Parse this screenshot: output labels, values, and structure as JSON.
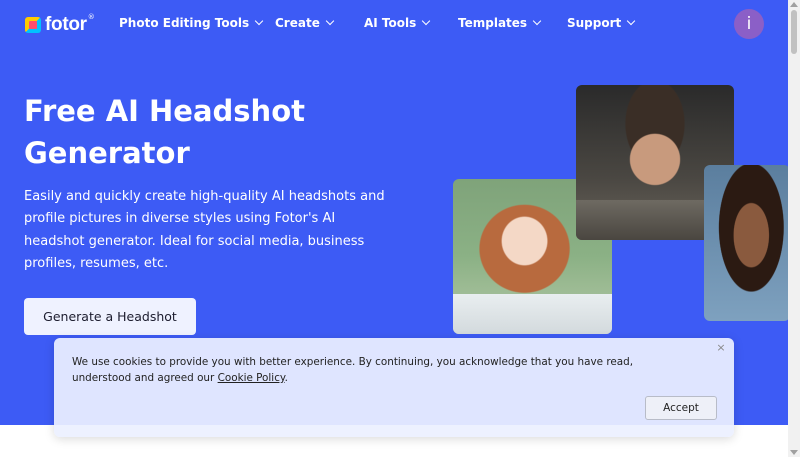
{
  "brand": {
    "logo_text": "fotor",
    "logo_mark": "®"
  },
  "nav": {
    "items": [
      {
        "label": "Photo Editing Tools"
      },
      {
        "label": "Create"
      },
      {
        "label": "AI Tools"
      },
      {
        "label": "Templates"
      },
      {
        "label": "Support"
      }
    ],
    "avatar_initial": "i"
  },
  "hero": {
    "title_line1": "Free AI Headshot",
    "title_line2": "Generator",
    "description": "Easily and quickly create high-quality AI headshots and profile pictures in diverse styles using Fotor's AI headshot generator. Ideal for social media, business profiles, resumes, etc.",
    "cta_label": "Generate a Headshot"
  },
  "cookie_banner": {
    "text_before_link": "We use cookies to provide you with better experience. By continuing, you acknowledge that you have read, understood and agreed our ",
    "link_text": "Cookie Policy",
    "text_after_link": ".",
    "close_symbol": "×",
    "accept_label": "Accept"
  },
  "colors": {
    "hero_background": "#3d5bf5",
    "avatar": "#8b5fc7",
    "cta_background": "#eff2ff"
  }
}
